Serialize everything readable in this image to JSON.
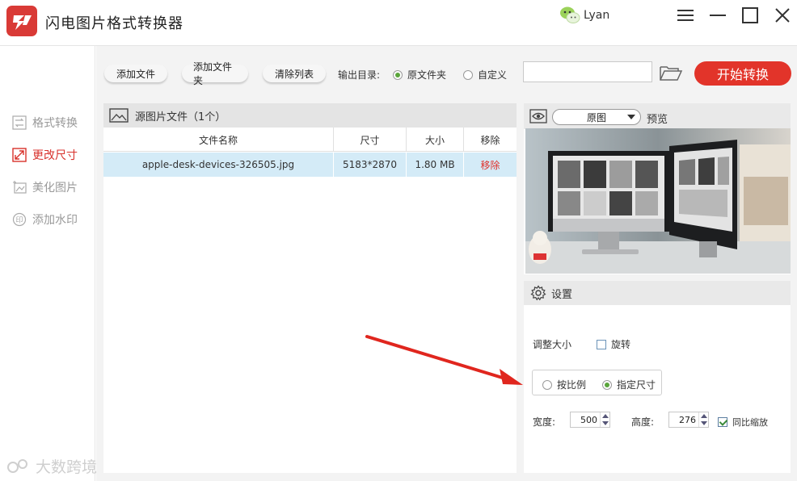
{
  "app": {
    "title": "闪电图片格式转换器",
    "user_name": "Lyan",
    "colors": {
      "brand_red": "#e2342a",
      "selected_row": "#d4ebf7",
      "radio_on": "#5aa53b"
    }
  },
  "window_controls": [
    "menu-icon",
    "minimize-icon",
    "maximize-icon",
    "close-icon"
  ],
  "sidebar": {
    "items": [
      {
        "label": "格式转换",
        "icon": "convert-icon",
        "active": false
      },
      {
        "label": "更改尺寸",
        "icon": "resize-icon",
        "active": true
      },
      {
        "label": "美化图片",
        "icon": "beautify-icon",
        "active": false
      },
      {
        "label": "添加水印",
        "icon": "watermark-icon",
        "active": false
      }
    ]
  },
  "toolbar": {
    "add_file": "添加文件",
    "add_folder": "添加文件夹",
    "clear_list": "清除列表",
    "output_label": "输出目录:",
    "output_original": "原文件夹",
    "output_custom": "自定义",
    "output_path": "",
    "start": "开始转换"
  },
  "file_panel": {
    "title": "源图片文件（1个）",
    "columns": [
      "文件名称",
      "尺寸",
      "大小",
      "移除"
    ],
    "rows": [
      {
        "name": "apple-desk-devices-326505.jpg",
        "dimensions": "5183*2870",
        "size": "1.80 MB",
        "remove": "移除"
      }
    ]
  },
  "preview": {
    "mode": "原图",
    "label": "预览"
  },
  "settings": {
    "title": "设置",
    "resize_label": "调整大小",
    "rotate_label": "旋转",
    "rotate_checked": false,
    "by_ratio": "按比例",
    "by_size": "指定尺寸",
    "mode_selected": "指定尺寸",
    "width_label": "宽度:",
    "width_value": "500",
    "height_label": "高度:",
    "height_value": "276",
    "keep_ratio_label": "同比缩放",
    "keep_ratio_checked": true
  },
  "watermark": "大数跨境"
}
